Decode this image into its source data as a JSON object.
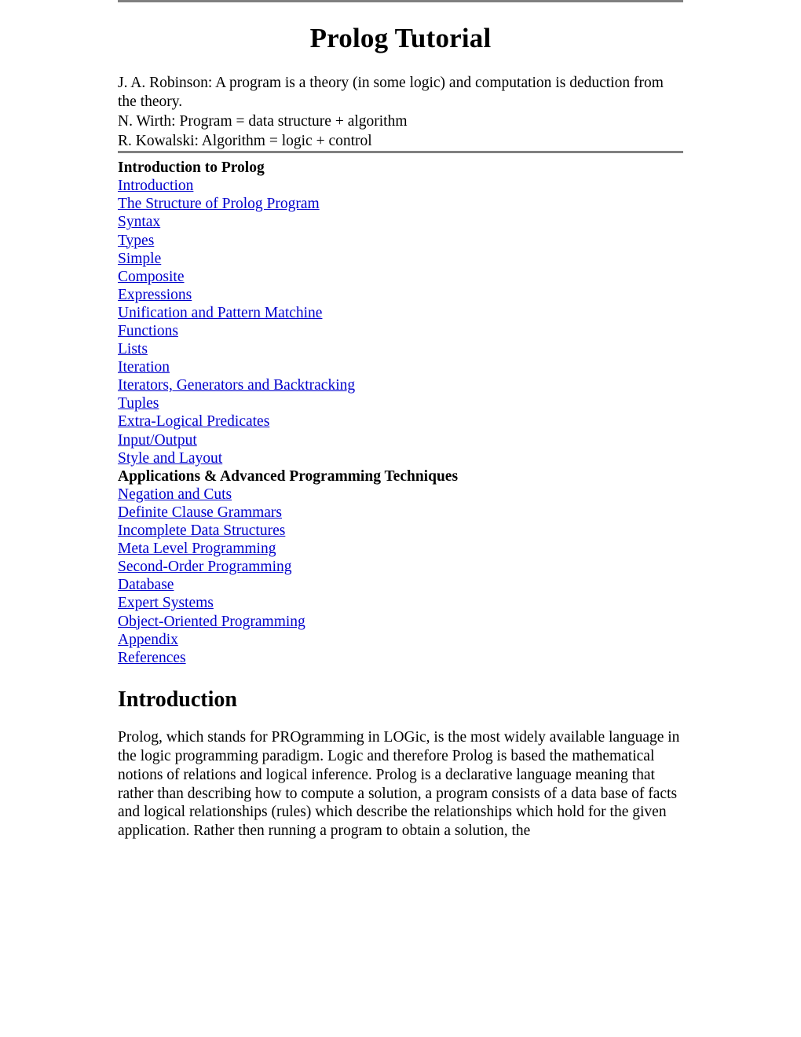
{
  "document": {
    "title": "Prolog Tutorial",
    "epigraph": [
      "J. A. Robinson: A program is a theory (in some logic) and computation is deduction from the theory.",
      "N. Wirth: Program = data structure + algorithm",
      "R. Kowalski: Algorithm = logic + control"
    ],
    "toc": [
      {
        "type": "heading",
        "label": "Introduction to Prolog"
      },
      {
        "type": "link",
        "label": "Introduction"
      },
      {
        "type": "link",
        "label": "The Structure of Prolog Program"
      },
      {
        "type": "link",
        "label": "Syntax"
      },
      {
        "type": "link",
        "label": "Types"
      },
      {
        "type": "link",
        "label": "Simple"
      },
      {
        "type": "link",
        "label": "Composite"
      },
      {
        "type": "link",
        "label": "Expressions"
      },
      {
        "type": "link",
        "label": "Unification and Pattern Matchine"
      },
      {
        "type": "link",
        "label": "Functions"
      },
      {
        "type": "link",
        "label": "Lists"
      },
      {
        "type": "link",
        "label": "Iteration"
      },
      {
        "type": "link",
        "label": "Iterators, Generators and Backtracking"
      },
      {
        "type": "link",
        "label": "Tuples"
      },
      {
        "type": "link",
        "label": "Extra-Logical Predicates"
      },
      {
        "type": "link",
        "label": "Input/Output"
      },
      {
        "type": "link",
        "label": "Style and Layout"
      },
      {
        "type": "heading",
        "label": "Applications & Advanced Programming Techniques"
      },
      {
        "type": "link",
        "label": "Negation and Cuts"
      },
      {
        "type": "link",
        "label": "Definite Clause Grammars"
      },
      {
        "type": "link",
        "label": "Incomplete Data Structures"
      },
      {
        "type": "link",
        "label": "Meta Level Programming"
      },
      {
        "type": "link",
        "label": "Second-Order Programming"
      },
      {
        "type": "link",
        "label": "Database"
      },
      {
        "type": "link",
        "label": "Expert Systems"
      },
      {
        "type": "link",
        "label": "Object-Oriented Programming"
      },
      {
        "type": "link",
        "label": "Appendix"
      },
      {
        "type": "link",
        "label": "References"
      }
    ],
    "section": {
      "heading": "Introduction",
      "paragraph": "Prolog, which stands for PROgramming in LOGic, is the most widely available language in the logic programming paradigm. Logic and therefore Prolog is based the mathematical notions of relations and logical inference. Prolog is a declarative language meaning that rather than describing how to compute a solution, a program consists of a data base of facts and logical relationships (rules) which describe the relationships which hold for the given application. Rather then running a program to obtain a solution, the"
    },
    "colors": {
      "link": "#0000cc",
      "rule": "#808080",
      "text": "#000000",
      "background": "#ffffff"
    }
  }
}
